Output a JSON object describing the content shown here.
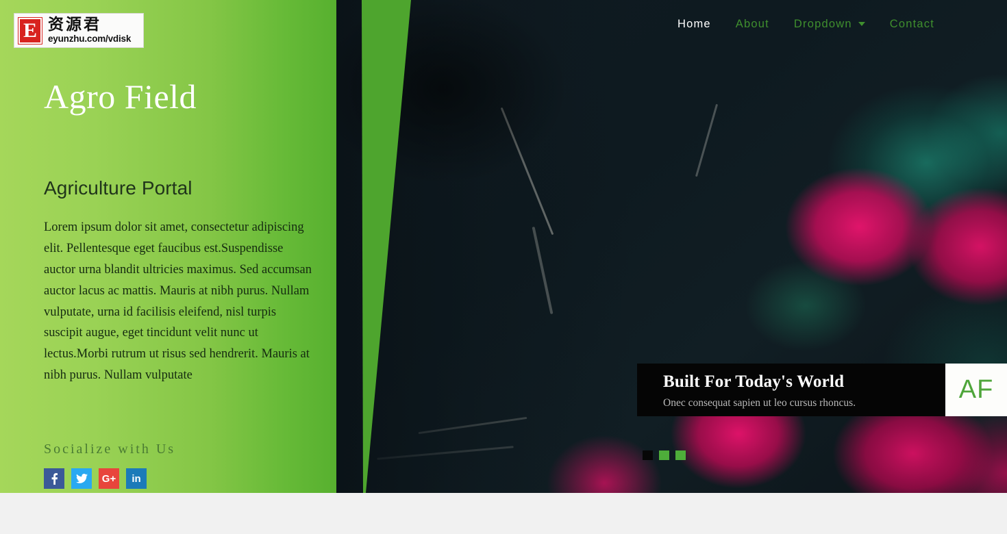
{
  "watermark": {
    "mark_letter": "E",
    "chinese": "资源君",
    "url": "eyunzhu.com/vdisk"
  },
  "nav": {
    "items": [
      {
        "label": "Home",
        "active": true,
        "has_caret": false
      },
      {
        "label": "About",
        "active": false,
        "has_caret": false
      },
      {
        "label": "Dropdown",
        "active": false,
        "has_caret": true
      },
      {
        "label": "Contact",
        "active": false,
        "has_caret": false
      }
    ],
    "active_color": "#ffffff",
    "link_color": "#3f8f2e"
  },
  "hero": {
    "title": "Agro Field",
    "subtitle": "Agriculture Portal",
    "body": "Lorem ipsum dolor sit amet, consectetur adipiscing elit. Pellentesque eget faucibus est.Suspendisse auctor urna blandit ultricies maximus. Sed accumsan auctor lacus ac mattis. Mauris at nibh purus. Nullam vulputate, urna id facilisis eleifend, nisl turpis suscipit augue, eget tincidunt velit nunc ut lectus.Morbi rutrum ut risus sed hendrerit. Mauris at nibh purus. Nullam vulputate",
    "gradient_from": "#a5d75a",
    "gradient_to": "#57b02f",
    "wedge_color": "#4ea52e",
    "photo_alt": "radishes on dark background"
  },
  "social": {
    "title": "Socialize with Us",
    "items": [
      {
        "name": "facebook",
        "label": "f",
        "color": "#3b5998"
      },
      {
        "name": "twitter",
        "label": "t",
        "color": "#29a9f1"
      },
      {
        "name": "google-plus",
        "label": "G+",
        "color": "#e8453c"
      },
      {
        "name": "linkedin",
        "label": "in",
        "color": "#1b7bb9"
      }
    ]
  },
  "caption": {
    "title": "Built For Today's World",
    "subtitle": "Onec consequat sapien ut leo cursus rhoncus.",
    "badge": "AF",
    "badge_color": "#4ea53a"
  },
  "carousel": {
    "indicators": [
      {
        "active": true
      },
      {
        "active": false
      },
      {
        "active": false
      }
    ],
    "active_color": "#070707",
    "inactive_color": "#4ead3a"
  }
}
